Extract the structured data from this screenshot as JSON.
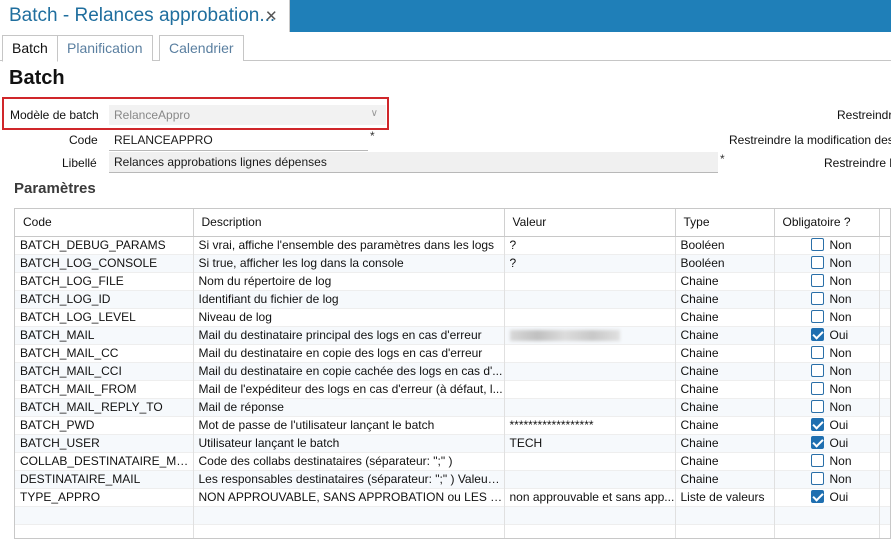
{
  "window": {
    "doc_tab_title": "Batch - Relances approbation...",
    "close_glyph": "✕"
  },
  "tabs": [
    "Batch",
    "Planification",
    "Calendrier"
  ],
  "page_title": "Batch",
  "form": {
    "model_label": "Modèle de batch",
    "model_value": "RelanceAppro",
    "code_label": "Code",
    "code_value": "RELANCEAPPRO",
    "libelle_label": "Libellé",
    "libelle_value": "Relances approbations lignes dépenses",
    "required_mark": "*",
    "right_labels": [
      "Restreindr",
      "Restreindre la modification des",
      "Restreindre le"
    ]
  },
  "params": {
    "section_title": "Paramètres",
    "columns": [
      "Code",
      "Description",
      "Valeur",
      "Type",
      "Obligatoire ?"
    ],
    "rows": [
      {
        "code": "BATCH_DEBUG_PARAMS",
        "description": "Si vrai, affiche l'ensemble des paramètres dans les logs",
        "value": "?",
        "type": "Booléen",
        "required": false,
        "required_label": "Non"
      },
      {
        "code": "BATCH_LOG_CONSOLE",
        "description": "Si true, afficher les log dans la console",
        "value": "?",
        "type": "Booléen",
        "required": false,
        "required_label": "Non"
      },
      {
        "code": "BATCH_LOG_FILE",
        "description": "Nom du répertoire de log",
        "value": "",
        "type": "Chaine",
        "required": false,
        "required_label": "Non"
      },
      {
        "code": "BATCH_LOG_ID",
        "description": "Identifiant du fichier de log",
        "value": "",
        "type": "Chaine",
        "required": false,
        "required_label": "Non"
      },
      {
        "code": "BATCH_LOG_LEVEL",
        "description": "Niveau de log",
        "value": "",
        "type": "Chaine",
        "required": false,
        "required_label": "Non"
      },
      {
        "code": "BATCH_MAIL",
        "description": "Mail du destinataire principal des logs en cas d'erreur",
        "value": "",
        "value_redacted": true,
        "type": "Chaine",
        "required": true,
        "required_label": "Oui"
      },
      {
        "code": "BATCH_MAIL_CC",
        "description": "Mail du destinataire en copie des logs en cas d'erreur",
        "value": "",
        "type": "Chaine",
        "required": false,
        "required_label": "Non"
      },
      {
        "code": "BATCH_MAIL_CCI",
        "description": "Mail du destinataire en copie cachée des logs en cas d'...",
        "value": "",
        "type": "Chaine",
        "required": false,
        "required_label": "Non"
      },
      {
        "code": "BATCH_MAIL_FROM",
        "description": "Mail de l'expéditeur des logs en cas d'erreur (à défaut, l...",
        "value": "",
        "type": "Chaine",
        "required": false,
        "required_label": "Non"
      },
      {
        "code": "BATCH_MAIL_REPLY_TO",
        "description": "Mail de réponse",
        "value": "",
        "type": "Chaine",
        "required": false,
        "required_label": "Non"
      },
      {
        "code": "BATCH_PWD",
        "description": "Mot de passe de l'utilisateur lançant le batch",
        "value": "******************",
        "type": "Chaine",
        "required": true,
        "required_label": "Oui"
      },
      {
        "code": "BATCH_USER",
        "description": "Utilisateur lançant le batch",
        "value": "TECH",
        "type": "Chaine",
        "required": true,
        "required_label": "Oui"
      },
      {
        "code": "COLLAB_DESTINATAIRE_MAIL",
        "description": "Code des collabs destinataires (séparateur: \";\" )",
        "value": "",
        "type": "Chaine",
        "required": false,
        "required_label": "Non"
      },
      {
        "code": "DESTINATAIRE_MAIL",
        "description": "Les responsables destinataires (séparateur: \";\" ) Valeurs :...",
        "value": "",
        "type": "Chaine",
        "required": false,
        "required_label": "Non"
      },
      {
        "code": "TYPE_APPRO",
        "description": "NON APPROUVABLE, SANS APPROBATION ou LES DEUX",
        "value": "non approuvable et sans app...",
        "type": "Liste de valeurs",
        "required": true,
        "required_label": "Oui"
      }
    ]
  },
  "colors": {
    "titlebar": "#1f7fb8",
    "highlight_border": "#d0262a",
    "checkbox_checked": "#1f6fb0"
  }
}
